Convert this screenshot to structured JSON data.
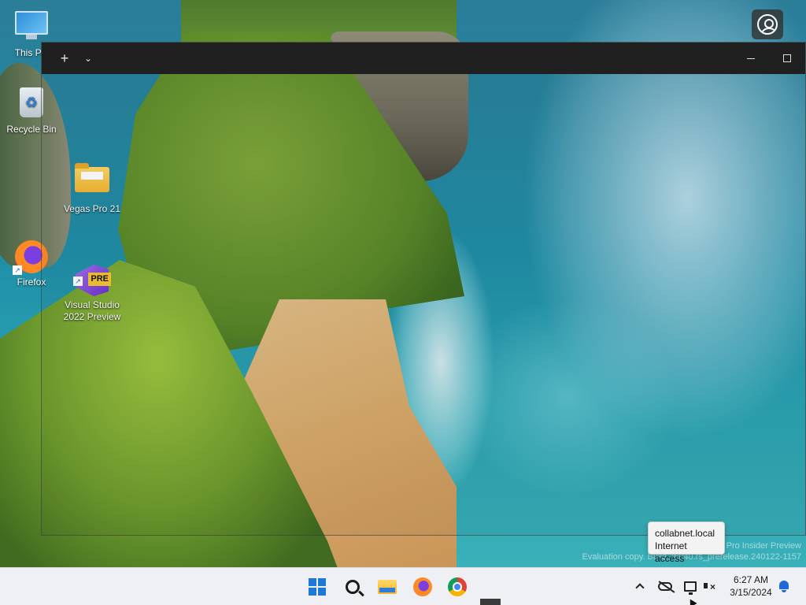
{
  "desktop": {
    "icons": [
      {
        "label": "This PC",
        "icon": "monitor-icon"
      },
      {
        "label": "Recycle Bin",
        "icon": "recycle-bin-icon"
      },
      {
        "label": "Vegas Pro 21",
        "icon": "folder-icon"
      },
      {
        "label": "Firefox",
        "icon": "firefox-icon"
      },
      {
        "label": "Visual Studio\n2022 Preview",
        "icon": "visual-studio-icon",
        "badge": "PRE"
      }
    ]
  },
  "window": {
    "new_tab_glyph": "+",
    "dropdown_glyph": "⌄"
  },
  "watermark": {
    "line1": "Pro Insider Preview",
    "line2": "Evaluation copy. Build 26040.rs_prerelease.240122-1157"
  },
  "tooltip": {
    "line1": "collabnet.local",
    "line2": "Internet access"
  },
  "taskbar": {
    "apps": [
      "start-icon",
      "search-icon",
      "file-explorer-icon",
      "firefox-icon",
      "chrome-icon"
    ],
    "clock": {
      "time": "6:27 AM",
      "date": "3/15/2024"
    }
  },
  "colors": {
    "taskbar_bg": "#eef0f3",
    "titlebar_bg": "#202020",
    "accent": "#1f78d6"
  }
}
